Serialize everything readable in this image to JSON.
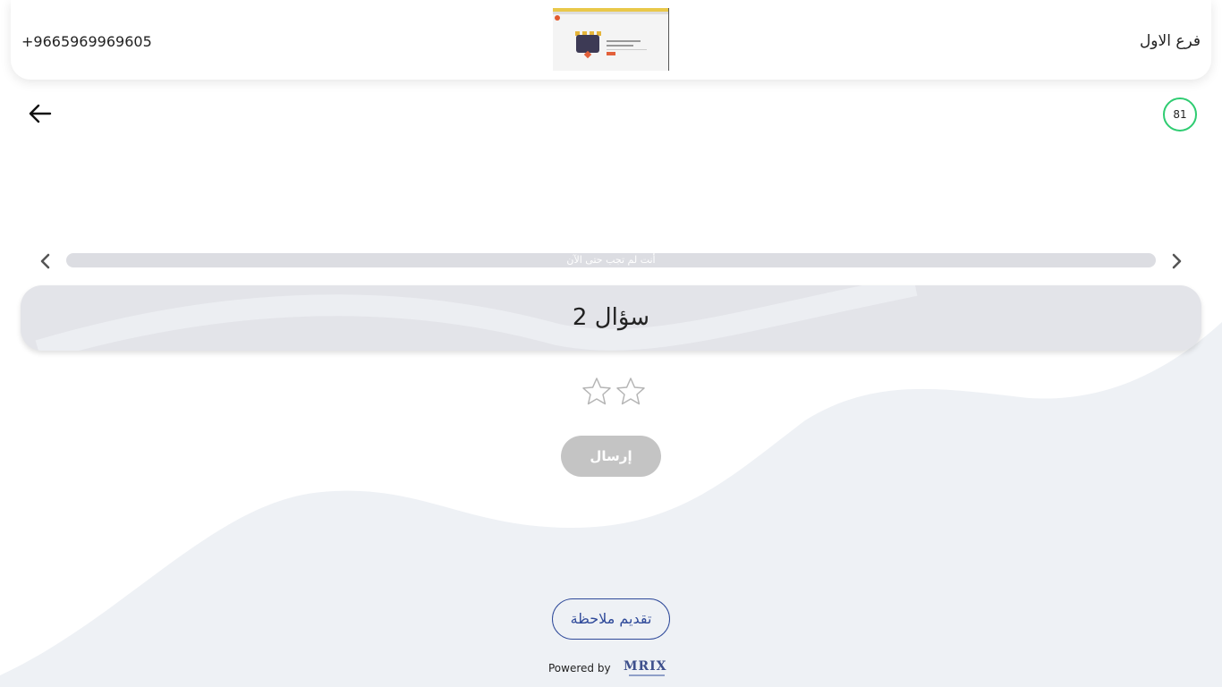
{
  "header": {
    "phone": "+9665969969605",
    "branch": "فرع الاول"
  },
  "timer": {
    "value": "81"
  },
  "progress": {
    "text": "أنت لم تجب حتى الآن"
  },
  "question": {
    "title": "سؤال 2"
  },
  "rating": {
    "max": 2,
    "selected": 0
  },
  "submit": {
    "label": "إرسال"
  },
  "feedback": {
    "label": "تقديم ملاحظة"
  },
  "footer": {
    "powered_by": "Powered by",
    "brand": "MRIX"
  },
  "colors": {
    "accent": "#2f4a9a",
    "timer_ring": "#2ecc71",
    "wave": "#eef1f5",
    "disabled_button": "#c4c4c4"
  },
  "icons": {
    "back": "arrow-left-icon",
    "prev": "chevron-left-icon",
    "next": "chevron-right-icon",
    "star": "star-outline-icon"
  }
}
